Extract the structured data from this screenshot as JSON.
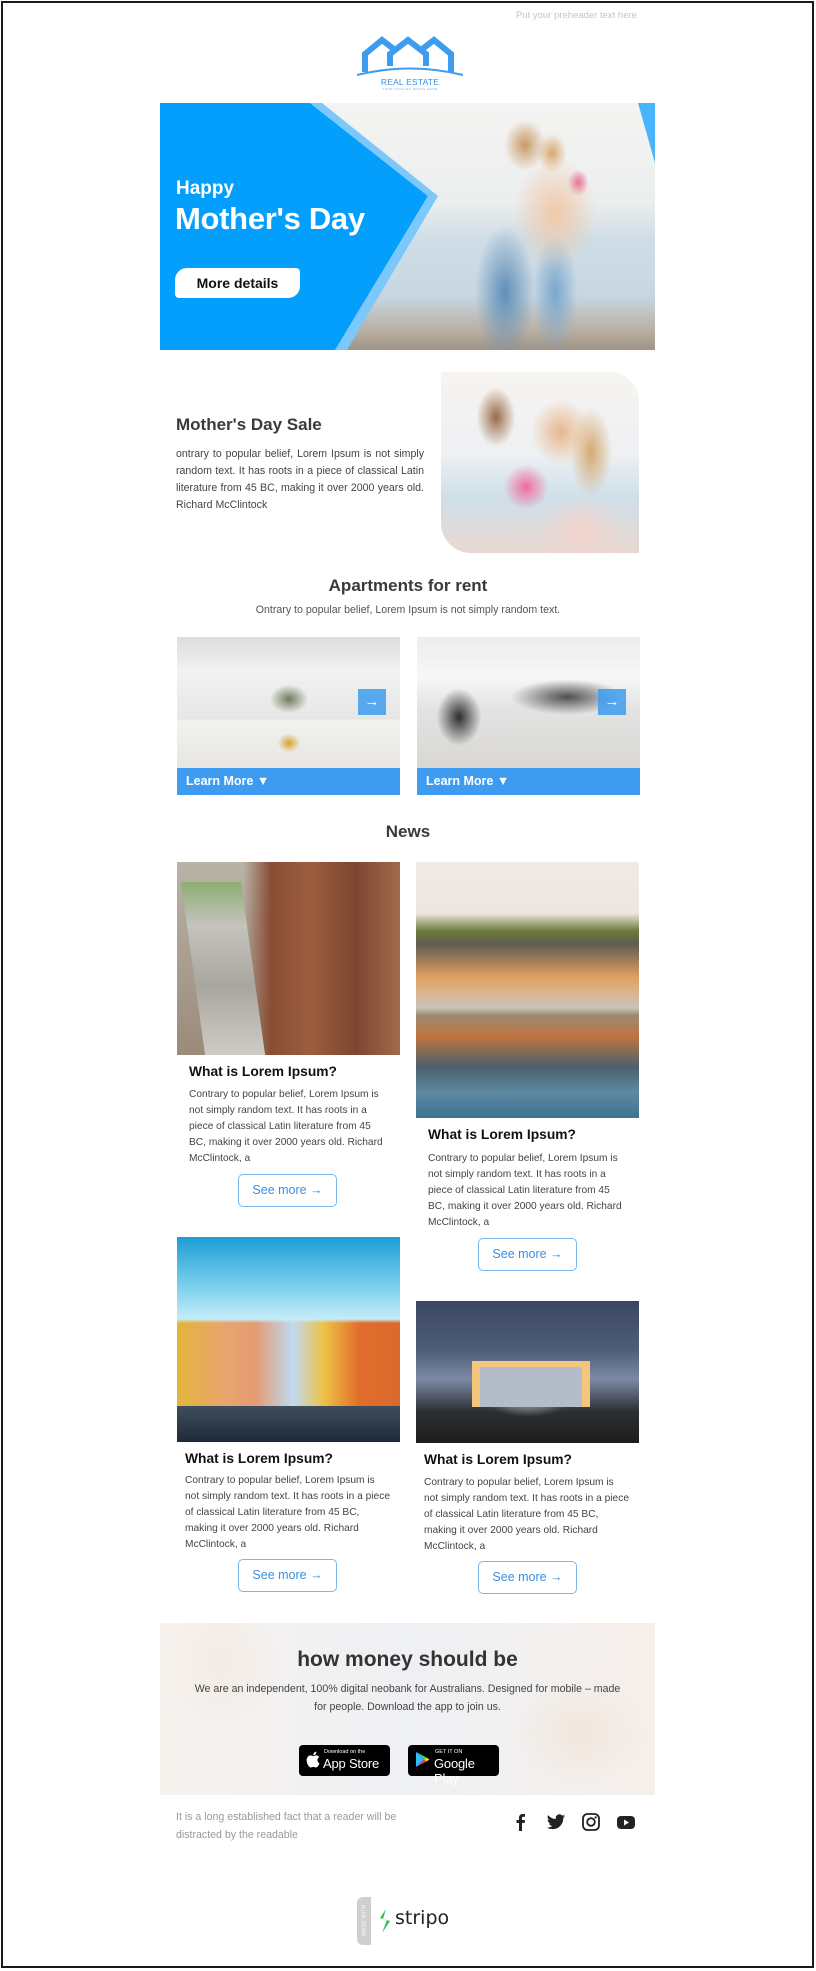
{
  "preheader": "Put your preheader text here",
  "logo": {
    "title": "REAL ESTATE",
    "tagline": "YOUR TAGLINE SPACE HERE",
    "icon": "houses-icon",
    "color": "#3d9cf0"
  },
  "hero": {
    "kicker": "Happy",
    "title": "Mother's Day",
    "button": "More details",
    "accent": "#049ffd",
    "image": "mother-daughter-hug-photo"
  },
  "sale": {
    "title": "Mother's Day Sale",
    "text": "ontrary to popular belief, Lorem Ipsum is not simply random text. It has roots in a piece of classical Latin literature from 45 BC, making it over 2000 years old. Richard McClintock",
    "image": "mother-daughter-flowers-photo"
  },
  "apartments": {
    "title": "Apartments for rent",
    "subtitle": "Ontrary to popular belief, Lorem Ipsum is not simply random text.",
    "cards": [
      {
        "label": "Learn More ▼",
        "arrow": "→",
        "image": "living-room-photo"
      },
      {
        "label": "Learn More ▼",
        "arrow": "→",
        "image": "sofa-chair-photo"
      }
    ]
  },
  "news": {
    "title": "News",
    "items": [
      {
        "heading": "What is Lorem Ipsum?",
        "text": "Contrary to popular belief, Lorem Ipsum is not simply random text. It has roots in a piece of classical Latin literature from 45 BC, making it over 2000 years old. Richard McClintock, a",
        "button": "See more →",
        "image": "city-street-photo"
      },
      {
        "heading": "What is Lorem Ipsum?",
        "text": "Contrary to popular belief, Lorem Ipsum is not simply random text. It has roots in a piece of classical Latin literature from 45 BC, making it over 2000 years old. Richard McClintock, a",
        "button": "See more →",
        "image": "riverside-town-photo"
      },
      {
        "heading": "What is Lorem Ipsum?",
        "text": "Contrary to popular belief, Lorem Ipsum is not simply random text. It has roots in a piece of classical Latin literature from 45 BC, making it over 2000 years old. Richard McClintock, a",
        "button": "See more →",
        "image": "colorful-houses-photo"
      },
      {
        "heading": "What is Lorem Ipsum?",
        "text": "Contrary to popular belief, Lorem Ipsum is not simply random text. It has roots in a piece of classical Latin literature from 45 BC, making it over 2000 years old. Richard McClintock, a",
        "button": "See more →",
        "image": "house-at-dusk-photo"
      }
    ]
  },
  "promo": {
    "title": "how money should be",
    "text": "We are an independent, 100% digital neobank for Australians. Designed for mobile – made for people. Download the app to join us.",
    "app_store": {
      "small": "Download on the",
      "big": "App Store"
    },
    "google_play": {
      "small": "GET IT ON",
      "big": "Google Play"
    }
  },
  "footer": {
    "text": "It is a long established fact that a reader will be distracted by the readable",
    "social": [
      "facebook",
      "twitter",
      "instagram",
      "youtube"
    ]
  },
  "badge": {
    "made_with": "MADE WITH",
    "brand": "stripo",
    "brand_color": "#2fbf4f"
  }
}
